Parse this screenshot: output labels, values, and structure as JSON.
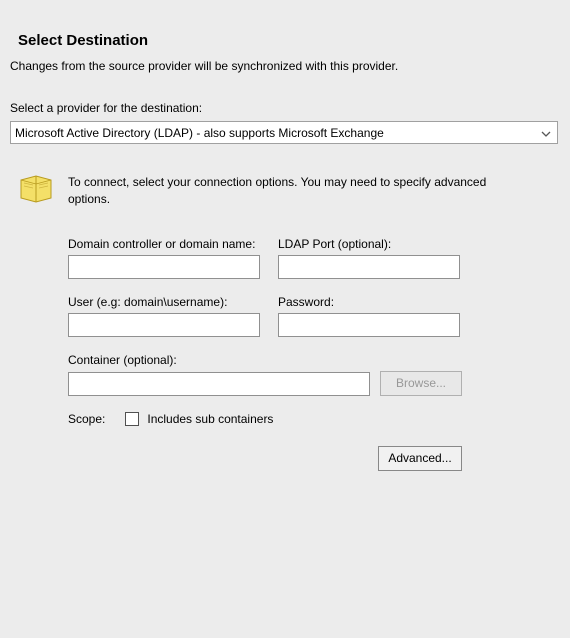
{
  "title": "Select Destination",
  "description": "Changes from the source provider will be synchronized with this provider.",
  "provider_label": "Select a provider for the destination:",
  "provider_selected": "Microsoft Active Directory (LDAP) - also supports Microsoft Exchange",
  "info_text": "To connect, select your connection options.  You may need to specify advanced options.",
  "labels": {
    "domain_controller": "Domain controller or domain name:",
    "ldap_port": "LDAP Port (optional):",
    "user": "User (e.g: domain\\username):",
    "password": "Password:",
    "container": "Container (optional):",
    "scope": "Scope:",
    "includes_sub": "Includes sub containers"
  },
  "values": {
    "domain_controller": "",
    "ldap_port": "",
    "user": "",
    "password": "",
    "container": "",
    "includes_sub_checked": false
  },
  "buttons": {
    "browse": "Browse...",
    "advanced": "Advanced..."
  }
}
